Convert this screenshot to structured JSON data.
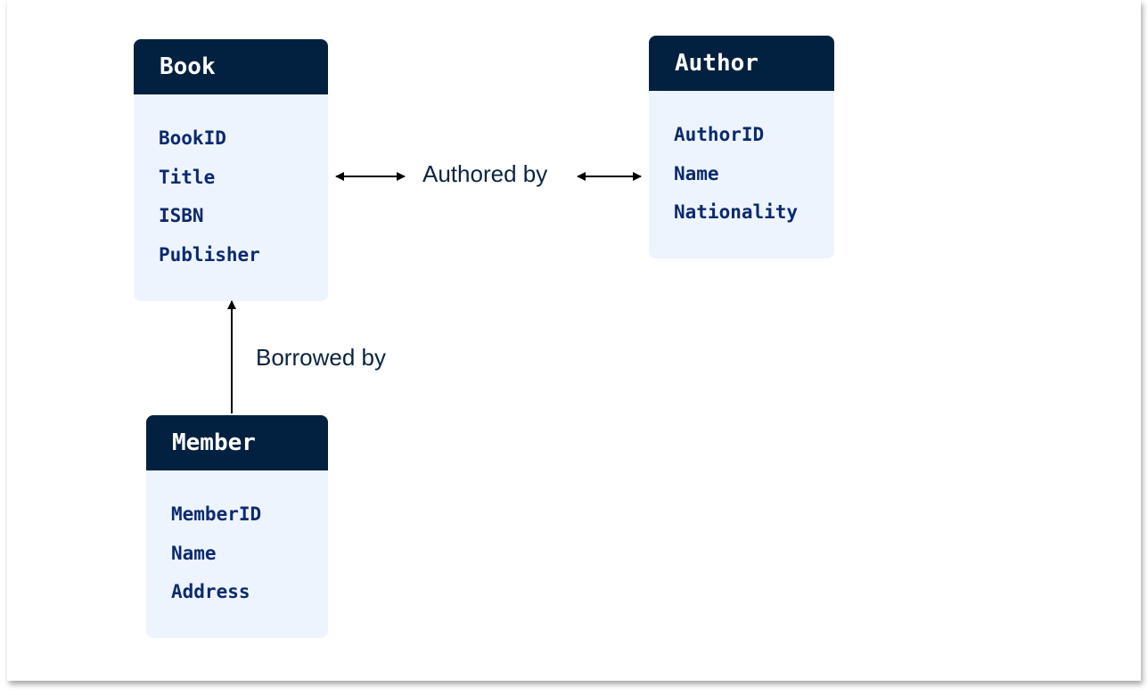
{
  "entities": {
    "book": {
      "title": "Book",
      "fields": [
        "BookID",
        "Title",
        "ISBN",
        "Publisher"
      ]
    },
    "author": {
      "title": "Author",
      "fields": [
        "AuthorID",
        "Name",
        "Nationality"
      ]
    },
    "member": {
      "title": "Member",
      "fields": [
        "MemberID",
        "Name",
        "Address"
      ]
    }
  },
  "relationships": {
    "authored": {
      "label": "Authored by",
      "direction": "bidirectional"
    },
    "borrowed": {
      "label": "Borrowed by",
      "direction": "member-to-book"
    }
  },
  "colors": {
    "header": "#022140",
    "body": "#edf4fe",
    "field_text": "#0b2a6e",
    "label_text": "#0a2440"
  }
}
